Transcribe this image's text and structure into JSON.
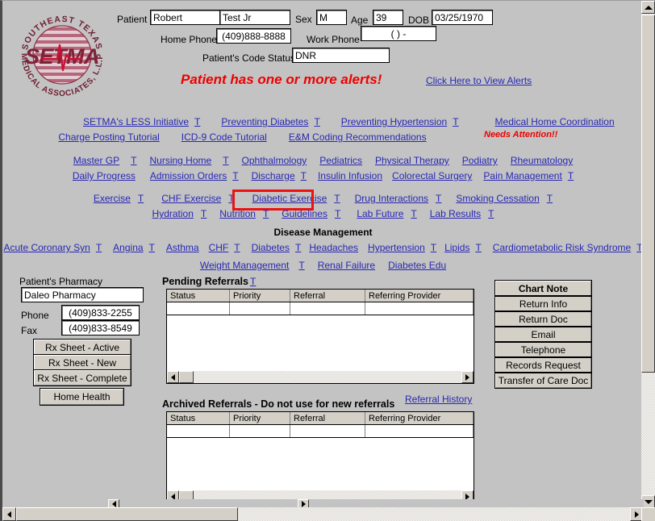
{
  "logo": {
    "top_arc_text": "SOUTHEAST TEXAS",
    "bottom_arc_text": "MEDICAL ASSOCIATES, L.L.P",
    "center_text": "SETMA",
    "colors": {
      "dark": "#8c2f46",
      "mid": "#b05a6e",
      "light": "#cf8e9c",
      "pulse": "#cc1133"
    }
  },
  "patient_header": {
    "patient_label": "Patient",
    "first_name": "Robert",
    "last_name": "Test Jr",
    "sex_label": "Sex",
    "sex": "M",
    "age_label": "Age",
    "age": "39",
    "dob_label": "DOB",
    "dob": "03/25/1970",
    "home_phone_label": "Home Phone",
    "home_phone": "(409)888-8888",
    "work_phone_label": "Work Phone",
    "work_phone": "(  )    -",
    "code_status_label": "Patient's Code Status",
    "code_status": "DNR",
    "alert_text": "Patient has one or more alerts!",
    "alert_link": "Click Here to View Alerts"
  },
  "nav": {
    "t_marker": "T",
    "row1": [
      {
        "label": "SETMA's LESS Initiative",
        "t": true
      },
      {
        "label": "Preventing Diabetes",
        "t": true
      },
      {
        "label": "Preventing Hypertension",
        "t": true
      },
      {
        "label": "Medical Home Coordination",
        "t": false
      }
    ],
    "needs_attention": "Needs Attention!!",
    "row2": [
      {
        "label": "Charge Posting Tutorial",
        "t": false
      },
      {
        "label": "ICD-9 Code Tutorial",
        "t": false
      },
      {
        "label": "E&M Coding Recommendations",
        "t": false
      }
    ],
    "row3": [
      {
        "label": "Master GP",
        "t": true
      },
      {
        "label": "Nursing Home",
        "t": true
      },
      {
        "label": "Ophthalmology",
        "t": false
      },
      {
        "label": "Pediatrics",
        "t": false
      },
      {
        "label": "Physical Therapy",
        "t": false
      },
      {
        "label": "Podiatry",
        "t": false
      },
      {
        "label": "Rheumatology",
        "t": false
      }
    ],
    "row4": [
      {
        "label": "Daily Progress",
        "t": false
      },
      {
        "label": "Admission Orders",
        "t": true
      },
      {
        "label": "Discharge",
        "t": true
      },
      {
        "label": "Insulin Infusion",
        "t": false
      },
      {
        "label": "Colorectal Surgery",
        "t": false
      },
      {
        "label": "Pain Management",
        "t": true
      }
    ],
    "row5": [
      {
        "label": "Exercise",
        "t": true
      },
      {
        "label": "CHF Exercise",
        "t": true
      },
      {
        "label": "Diabetic Exercise",
        "t": true,
        "highlighted": true
      },
      {
        "label": "Drug Interactions",
        "t": true
      },
      {
        "label": "Smoking Cessation",
        "t": true
      }
    ],
    "row6": [
      {
        "label": "Hydration",
        "t": true
      },
      {
        "label": "Nutrition",
        "t": true
      },
      {
        "label": "Guidelines",
        "t": true
      },
      {
        "label": "Lab Future",
        "t": true
      },
      {
        "label": "Lab Results",
        "t": true
      }
    ]
  },
  "disease_management": {
    "title": "Disease Management",
    "row1": [
      {
        "label": "Acute Coronary Syn",
        "t": true
      },
      {
        "label": "Angina",
        "t": true
      },
      {
        "label": "Asthma",
        "t": false
      },
      {
        "label": "CHF",
        "t": true
      },
      {
        "label": "Diabetes",
        "t": true
      },
      {
        "label": "Headaches",
        "t": false
      },
      {
        "label": "Hypertension",
        "t": true
      },
      {
        "label": "Lipids",
        "t": true
      },
      {
        "label": "Cardiometabolic Risk Syndrome",
        "t": true
      }
    ],
    "row2": [
      {
        "label": "Weight Management",
        "t": true
      },
      {
        "label": "Renal Failure",
        "t": false
      },
      {
        "label": "Diabetes Edu",
        "t": false
      }
    ]
  },
  "pharmacy": {
    "title": "Patient's Pharmacy",
    "name": "Daleo Pharmacy",
    "phone_label": "Phone",
    "phone": "(409)833-2255",
    "fax_label": "Fax",
    "fax": "(409)833-8549",
    "buttons": [
      "Rx Sheet - Active",
      "Rx Sheet - New",
      "Rx Sheet - Complete"
    ],
    "home_health_button": "Home Health"
  },
  "pending_referrals": {
    "title": "Pending Referrals",
    "t_marker": "T",
    "columns": [
      "Status",
      "Priority",
      "Referral",
      "Referring Provider"
    ],
    "rows": []
  },
  "archived_referrals": {
    "title": "Archived Referrals - Do not use for new referrals",
    "history_link": "Referral History",
    "columns": [
      "Status",
      "Priority",
      "Referral",
      "Referring Provider"
    ],
    "rows": []
  },
  "action_buttons": [
    {
      "label": "Chart Note",
      "bold": true
    },
    {
      "label": "Return Info",
      "bold": false
    },
    {
      "label": "Return Doc",
      "bold": false
    },
    {
      "label": "Email",
      "bold": false
    },
    {
      "label": "Telephone",
      "bold": false
    },
    {
      "label": "Records Request",
      "bold": false
    },
    {
      "label": "Transfer of Care Doc",
      "bold": false
    }
  ],
  "scrollbars": {
    "up_arrow": "up-arrow-icon",
    "down_arrow": "down-arrow-icon",
    "left_arrow": "left-arrow-icon",
    "right_arrow": "right-arrow-icon"
  }
}
